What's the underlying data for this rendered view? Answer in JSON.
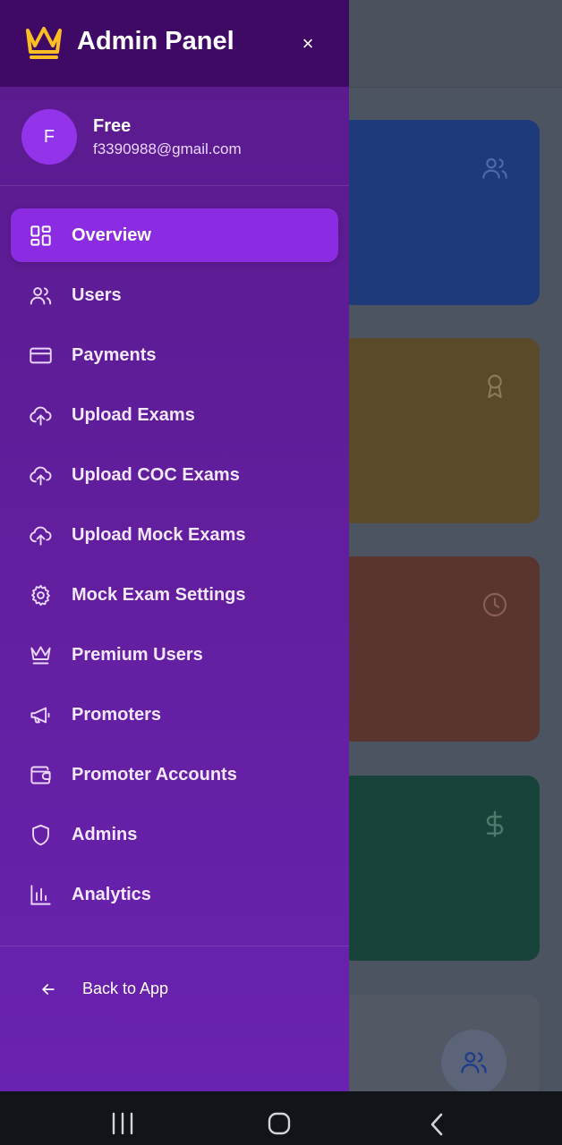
{
  "drawer": {
    "title": "Admin Panel",
    "close_symbol": "×",
    "logo_icon": "crown-icon",
    "accent_color": "#fbbf24"
  },
  "profile": {
    "initial": "F",
    "name": "Free",
    "email": "f3390988@gmail.com"
  },
  "nav": {
    "items": [
      {
        "label": "Overview",
        "icon": "grid-icon",
        "active": true
      },
      {
        "label": "Users",
        "icon": "users-icon"
      },
      {
        "label": "Payments",
        "icon": "credit-card-icon"
      },
      {
        "label": "Upload Exams",
        "icon": "cloud-upload-icon"
      },
      {
        "label": "Upload COC Exams",
        "icon": "cloud-upload-icon"
      },
      {
        "label": "Upload Mock Exams",
        "icon": "cloud-upload-icon"
      },
      {
        "label": "Mock Exam Settings",
        "icon": "gear-icon"
      },
      {
        "label": "Premium Users",
        "icon": "crown-icon"
      },
      {
        "label": "Promoters",
        "icon": "megaphone-icon"
      },
      {
        "label": "Promoter Accounts",
        "icon": "wallet-icon"
      },
      {
        "label": "Admins",
        "icon": "shield-icon"
      },
      {
        "label": "Analytics",
        "icon": "bar-chart-icon"
      }
    ]
  },
  "footer": {
    "back_label": "Back to App"
  }
}
